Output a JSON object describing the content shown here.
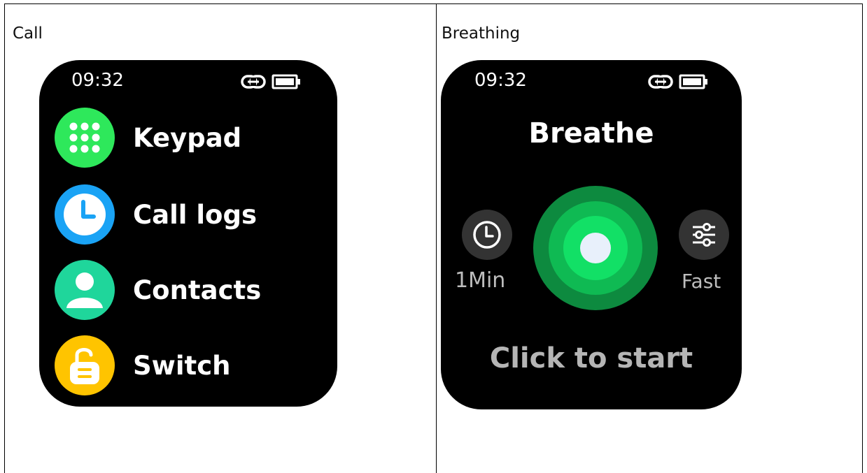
{
  "panels": {
    "left_caption": "Call",
    "right_caption": "Breathing"
  },
  "call_watch": {
    "time": "09:32",
    "items": [
      {
        "label": "Keypad",
        "icon": "keypad-icon",
        "color": "#2ee85b"
      },
      {
        "label": "Call logs",
        "icon": "clock-icon",
        "color": "#1aa3f5"
      },
      {
        "label": "Contacts",
        "icon": "person-icon",
        "color": "#1fd69b"
      },
      {
        "label": "Switch",
        "icon": "unlock-icon",
        "color": "#ffc400"
      }
    ]
  },
  "breathe_watch": {
    "time": "09:32",
    "title": "Breathe",
    "duration_label": "1Min",
    "speed_label": "Fast",
    "start_label": "Click to start",
    "colors": {
      "outer": "#0d8a3f",
      "middle": "#0fba53",
      "inner": "#12e066",
      "dot": "#e8f0fb"
    }
  }
}
